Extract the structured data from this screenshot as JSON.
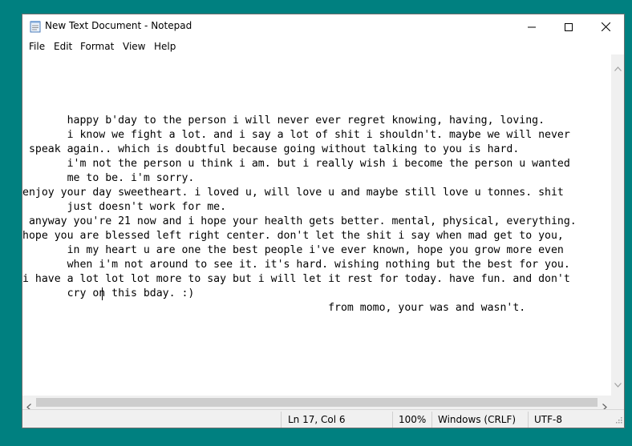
{
  "window": {
    "title": "New Text Document - Notepad",
    "controls": {
      "minimize": "minimize",
      "maximize": "maximize",
      "close": "close"
    }
  },
  "menu": [
    "File",
    "Edit",
    "Format",
    "View",
    "Help"
  ],
  "editor": {
    "lines": [
      "       happy b'day to the person i will never ever regret knowing, having, loving.",
      "       i know we fight a lot. and i say a lot of shit i shouldn't. maybe we will never",
      " speak again.. which is doubtful because going without talking to you is hard.",
      "       i'm not the person u think i am. but i really wish i become the person u wanted",
      "       me to be. i'm sorry.",
      "enjoy your day sweetheart. i loved u, will love u and maybe still love u tonnes. shit",
      "       just doesn't work for me.",
      " anyway you're 21 now and i hope your health gets better. mental, physical, everything.",
      "hope you are blessed left right center. don't let the shit i say when mad get to you,",
      "       in my heart u are one the best people i've ever known, hope you grow more even",
      "       when i'm not around to see it. it's hard. wishing nothing but the best for you.",
      "i have a lot lot lot more to say but i will let it rest for today. have fun. and don't",
      "       cry on this bday. :)",
      "                                                from momo, your was and wasn't."
    ]
  },
  "status": {
    "position": "Ln 17, Col 6",
    "zoom": "100%",
    "line_ending": "Windows (CRLF)",
    "encoding": "UTF-8"
  }
}
